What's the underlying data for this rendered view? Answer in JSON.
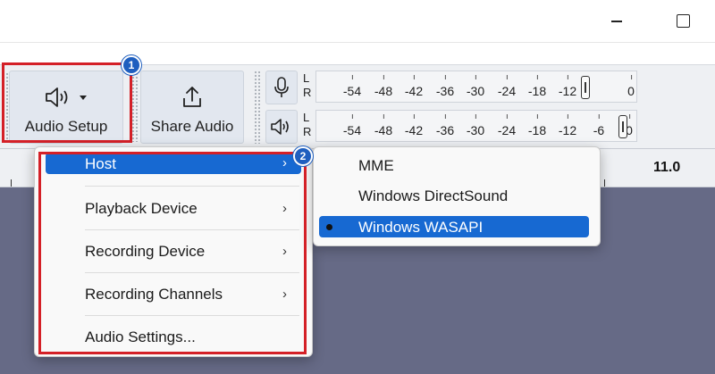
{
  "toolbar": {
    "audio_setup_label": "Audio Setup",
    "share_audio_label": "Share Audio"
  },
  "badges": {
    "first": "1",
    "second": "2"
  },
  "meters": {
    "channel_left": "L",
    "channel_right": "R",
    "recording_ticks": [
      "-54",
      "-48",
      "-42",
      "-36",
      "-30",
      "-24",
      "-18",
      "-12",
      "0"
    ],
    "playback_ticks": [
      "-54",
      "-48",
      "-42",
      "-36",
      "-30",
      "-24",
      "-18",
      "-12",
      "-6",
      "0"
    ]
  },
  "ruler": {
    "label": "11.0"
  },
  "menu": {
    "items": [
      {
        "label": "Host",
        "has_submenu": true,
        "active": true
      },
      {
        "label": "Playback Device",
        "has_submenu": true
      },
      {
        "label": "Recording Device",
        "has_submenu": true
      },
      {
        "label": "Recording Channels",
        "has_submenu": true
      },
      {
        "label": "Audio Settings...",
        "has_submenu": false
      }
    ]
  },
  "submenu": {
    "items": [
      {
        "label": "MME",
        "selected": false
      },
      {
        "label": "Windows DirectSound",
        "selected": false
      },
      {
        "label": "Windows WASAPI",
        "selected": true
      }
    ]
  },
  "colors": {
    "highlight": "#d42027",
    "badge": "#1f5fbf",
    "menu_active": "#1769d2",
    "track_bg": "#666a86"
  },
  "icons": [
    "speaker-icon",
    "dropdown-caret-icon",
    "share-icon",
    "microphone-icon",
    "speaker-icon",
    "chevron-right-icon",
    "bullet-icon"
  ]
}
